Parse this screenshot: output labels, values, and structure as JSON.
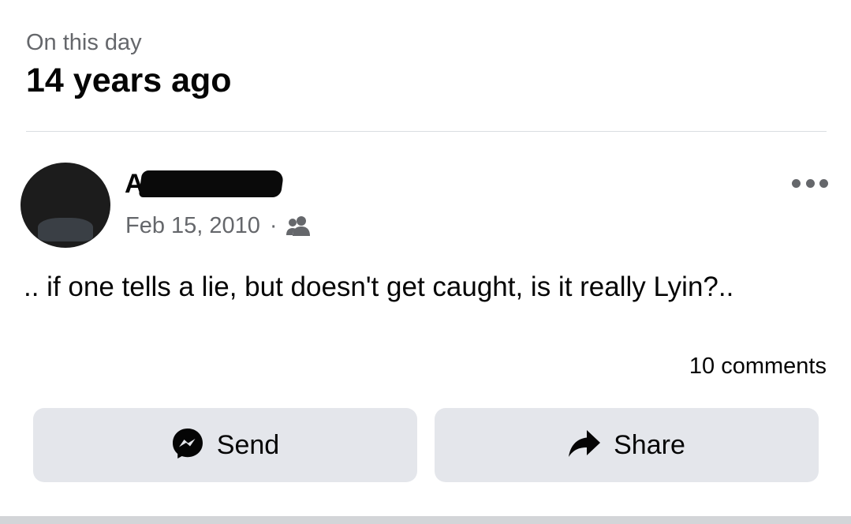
{
  "header": {
    "subtitle": "On this day",
    "title": "14 years ago"
  },
  "post": {
    "author_visible": "A ie",
    "date": "Feb 15, 2010",
    "separator": "·",
    "audience_icon": "friends-icon",
    "text": ".. if one tells a lie, but doesn't get caught, is it really Lyin?..",
    "comments": "10 comments"
  },
  "actions": {
    "send_label": "Send",
    "send_icon": "messenger-icon",
    "share_label": "Share",
    "share_icon": "share-arrow-icon"
  },
  "colors": {
    "text_primary": "#050505",
    "text_secondary": "#65676b",
    "button_bg": "#e4e6eb",
    "divider": "#dadde1"
  }
}
